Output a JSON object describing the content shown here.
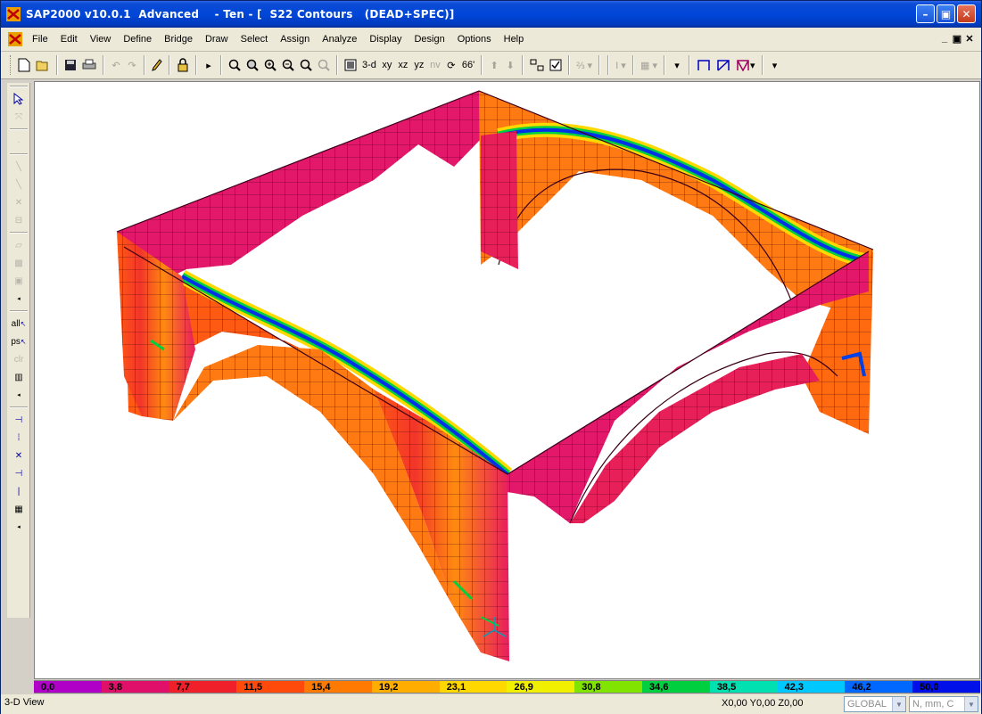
{
  "window": {
    "title": "SAP2000 v10.0.1  Advanced    - Ten - [  S22 Contours   (DEAD+SPEC)]",
    "controls": {
      "minimize": "–",
      "restore": "▣",
      "close": "✕"
    }
  },
  "menu": {
    "items": [
      "File",
      "Edit",
      "View",
      "Define",
      "Bridge",
      "Draw",
      "Select",
      "Assign",
      "Analyze",
      "Display",
      "Design",
      "Options",
      "Help"
    ],
    "mdi": {
      "minimize": "_",
      "restore": "▣",
      "close": "✕"
    }
  },
  "toolbar": {
    "views": {
      "three_d": "3-d",
      "xy": "xy",
      "xz": "xz",
      "yz": "yz",
      "nv": "nv"
    },
    "icons": [
      "new-icon",
      "open-icon",
      "save-icon",
      "print-icon",
      "undo-icon",
      "redo-icon",
      "pencil-icon",
      "lock-icon",
      "run-icon",
      "zoom-window-icon",
      "zoom-extents-icon",
      "zoom-in-icon",
      "zoom-out-icon",
      "pan-icon",
      "refresh-icon",
      "rotate-icon",
      "perspective-icon",
      "up-icon",
      "down-icon",
      "object-shrink-icon",
      "set-display-icon"
    ]
  },
  "left_toolbar": {
    "labels": {
      "all": "all",
      "ps": "ps",
      "clr": "clr"
    }
  },
  "colorbar": {
    "labels": [
      "0,0",
      "3,8",
      "7,7",
      "11,5",
      "15,4",
      "19,2",
      "23,1",
      "26,9",
      "30,8",
      "34,6",
      "38,5",
      "42,3",
      "46,2",
      "50,0"
    ],
    "colors": [
      "#b000c8",
      "#e0106a",
      "#f0202a",
      "#ff4a0c",
      "#ff7a00",
      "#ffae00",
      "#ffd800",
      "#f0f000",
      "#80e400",
      "#00d040",
      "#00e0b0",
      "#00c8ff",
      "#0068ff",
      "#0010e8"
    ]
  },
  "status": {
    "view_name": "3-D View",
    "coords": "X0,00  Y0,00  Z0,00",
    "coord_system": "GLOBAL",
    "units": "N, mm, C"
  }
}
